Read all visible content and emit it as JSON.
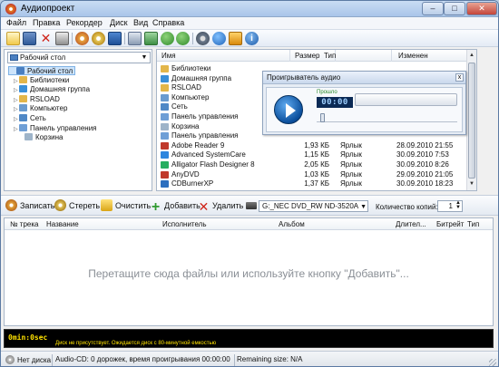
{
  "window": {
    "title": "Аудиопроект",
    "minimize": "–",
    "maximize": "□",
    "close": "✕"
  },
  "menu": [
    "Файл",
    "Правка",
    "Рекордер",
    "Диск",
    "Вид",
    "Справка"
  ],
  "toolbar_icons": [
    "new-icon",
    "save-icon",
    "delete-icon",
    "print-icon",
    "cd-add-icon",
    "cd-remove-icon",
    "burn-icon",
    "copy-disc-icon",
    "grid-icon",
    "back-icon",
    "forward-icon",
    "settings-icon",
    "globe-icon",
    "help-icon",
    "info-icon"
  ],
  "tree": {
    "location": "Рабочий стол",
    "items": [
      {
        "label": "Рабочий стол",
        "expander": "",
        "color": "#4a7fc1",
        "selected": true
      },
      {
        "label": "Библиотеки",
        "expander": "▷",
        "color": "#e3b64a"
      },
      {
        "label": "Домашняя группа",
        "expander": "▷",
        "color": "#3a8fd8"
      },
      {
        "label": "RSLOAD",
        "expander": "▷",
        "color": "#e3b64a"
      },
      {
        "label": "Компьютер",
        "expander": "▷",
        "color": "#6a9bcf"
      },
      {
        "label": "Сеть",
        "expander": "▷",
        "color": "#4f88c6"
      },
      {
        "label": "Панель управления",
        "expander": "▷",
        "color": "#6f9fd6"
      },
      {
        "label": "Корзина",
        "expander": "",
        "color": "#9eb4c9"
      }
    ]
  },
  "files": {
    "columns": {
      "name": "Имя",
      "size": "Размер",
      "type": "Тип",
      "modified": "Изменен"
    },
    "rows": [
      {
        "name": "Библиотеки",
        "size": "",
        "type": "",
        "date": "",
        "color": "#e3b64a"
      },
      {
        "name": "Домашняя группа",
        "size": "",
        "type": "",
        "date": "",
        "color": "#3a8fd8"
      },
      {
        "name": "RSLOAD",
        "size": "",
        "type": "",
        "date": "",
        "color": "#e3b64a"
      },
      {
        "name": "Компьютер",
        "size": "",
        "type": "",
        "date": "",
        "color": "#6a9bcf"
      },
      {
        "name": "Сеть",
        "size": "",
        "type": "",
        "date": "",
        "color": "#4f88c6"
      },
      {
        "name": "Панель управления",
        "size": "",
        "type": "",
        "date": "",
        "color": "#6f9fd6"
      },
      {
        "name": "Корзина",
        "size": "",
        "type": "",
        "date": "",
        "color": "#9eb4c9"
      },
      {
        "name": "Панель управления",
        "size": "",
        "type": "",
        "date": "",
        "color": "#6f9fd6"
      },
      {
        "name": "Adobe Reader 9",
        "size": "1,93 КБ",
        "type": "Ярлык",
        "date": "28.09.2010 21:55",
        "color": "#c0392b"
      },
      {
        "name": "Advanced SystemCare",
        "size": "1,15 КБ",
        "type": "Ярлык",
        "date": "30.09.2010 7:53",
        "color": "#2e86de"
      },
      {
        "name": "Alligator Flash Designer 8",
        "size": "2,05 КБ",
        "type": "Ярлык",
        "date": "30.09.2010 8:26",
        "color": "#27ae60"
      },
      {
        "name": "AnyDVD",
        "size": "1,03 КБ",
        "type": "Ярлык",
        "date": "29.09.2010 21:05",
        "color": "#c0392b"
      },
      {
        "name": "CDBurnerXP",
        "size": "1,37 КБ",
        "type": "Ярлык",
        "date": "30.09.2010 18:23",
        "color": "#2c6fbf"
      }
    ]
  },
  "player": {
    "title": "Проигрыватель аудио",
    "elapsed_label": "Прошло",
    "time": "00:00",
    "close": "x"
  },
  "actions": {
    "record": "Записать",
    "erase": "Стереть",
    "clear": "Очистить",
    "add": "Добавить",
    "remove": "Удалить",
    "drive": "G:_NEC DVD_RW ND-3520A",
    "copies_label": "Количество копий:",
    "copies": "1"
  },
  "tracks": {
    "columns": {
      "num": "№ трека",
      "name": "Название",
      "artist": "Исполнитель",
      "album": "Альбом",
      "duration": "Длител...",
      "bitrate": "Битрейт",
      "type": "Тип"
    },
    "empty_message": "Перетащите сюда файлы или используйте кнопку \"Добавить\"..."
  },
  "cd_meter": {
    "time": "0min:0sec",
    "message": "Диск не присутствует. Ожидается диск с 80-минутной емкостью"
  },
  "status": {
    "disk": "Нет диска",
    "info": "Audio-CD: 0 дорожек, время проигрывания 00:00:00",
    "remaining": "Remaining size: N/A"
  },
  "colors": {
    "accent": "#0b4f9c",
    "meter_text": "#ffe200"
  }
}
